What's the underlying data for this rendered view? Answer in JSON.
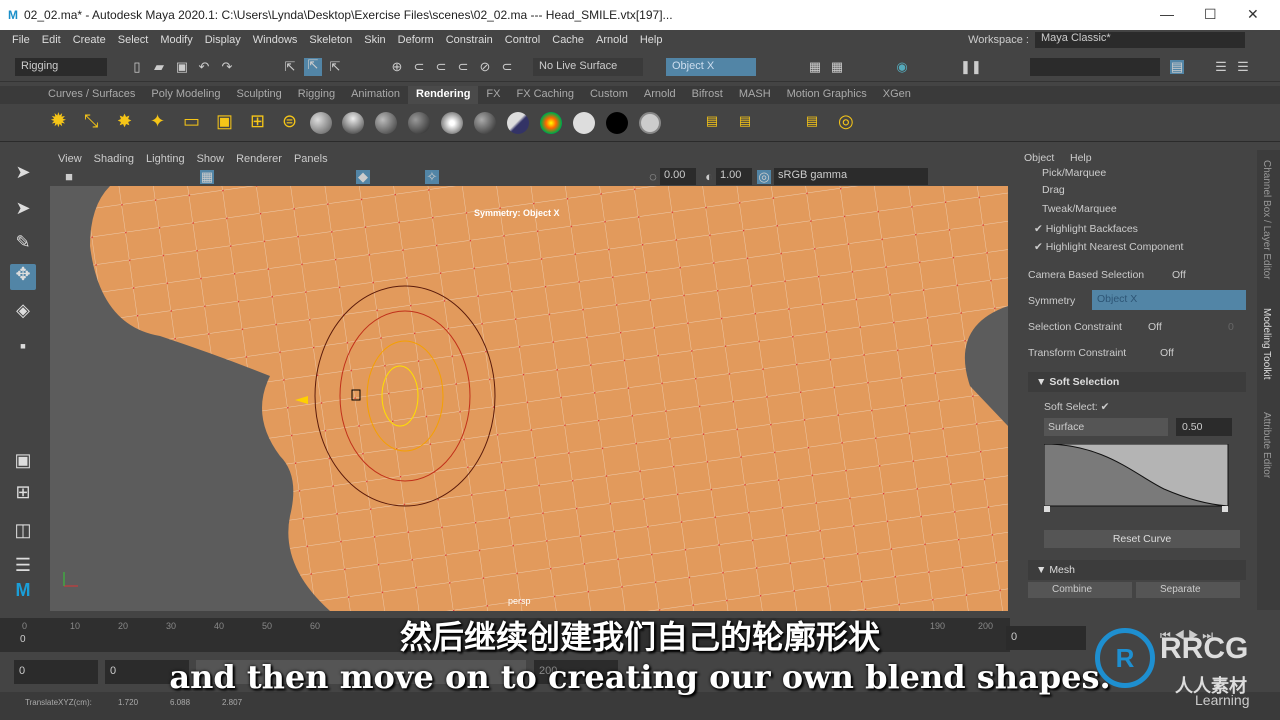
{
  "window": {
    "title": "02_02.ma* - Autodesk Maya 2020.1: C:\\Users\\Lynda\\Desktop\\Exercise Files\\scenes\\02_02.ma   ---   Head_SMILE.vtx[197]...",
    "logo": "M"
  },
  "menu": [
    "File",
    "Edit",
    "Create",
    "Select",
    "Modify",
    "Display",
    "Windows",
    "Skeleton",
    "Skin",
    "Deform",
    "Constrain",
    "Control",
    "Cache",
    "Arnold",
    "Help"
  ],
  "workspace": {
    "label": "Workspace :",
    "value": "Maya Classic*"
  },
  "status": {
    "menuset": "Rigging",
    "live_surface": "No Live Surface",
    "symmetry": "Object X"
  },
  "shelf_tabs": [
    "Curves / Surfaces",
    "Poly Modeling",
    "Sculpting",
    "Rigging",
    "Animation",
    "Rendering",
    "FX",
    "FX Caching",
    "Custom",
    "Arnold",
    "Bifrost",
    "MASH",
    "Motion Graphics",
    "XGen"
  ],
  "shelf_active": "Rendering",
  "viewport": {
    "menu": [
      "View",
      "Shading",
      "Lighting",
      "Show",
      "Renderer",
      "Panels"
    ],
    "exposure": "0.00",
    "gamma": "1.00",
    "colorspace": "sRGB gamma",
    "symmetry_hud": "Symmetry: Object X",
    "camera": "persp",
    "mesh_color": "#e29a5c"
  },
  "panel": {
    "menu": [
      "Object",
      "Help"
    ],
    "pick": "Pick/Marquee",
    "drag": "Drag",
    "tweak": "Tweak/Marquee",
    "highlight_backfaces": "Highlight Backfaces",
    "highlight_nearest": "Highlight Nearest Component",
    "camera_sel_label": "Camera Based Selection",
    "camera_sel_value": "Off",
    "symmetry_label": "Symmetry",
    "symmetry_value": "Object X",
    "sel_constraint_label": "Selection Constraint",
    "sel_constraint_value": "Off",
    "sel_constraint_num": "0",
    "xform_constraint_label": "Transform Constraint",
    "xform_constraint_value": "Off",
    "soft_section": "Soft Selection",
    "soft_select_label": "Soft Select:",
    "falloff_mode": "Surface",
    "falloff_radius": "0.50",
    "reset_curve": "Reset Curve",
    "mesh_section": "Mesh",
    "combine": "Combine",
    "separate": "Separate"
  },
  "side_tabs": [
    "Channel Box / Layer Editor",
    "Modeling Toolkit",
    "Attribute Editor"
  ],
  "timeline": {
    "ticks": [
      "0",
      "10",
      "20",
      "30",
      "40",
      "50",
      "60",
      "190",
      "200"
    ],
    "current": "0",
    "current_field": "0"
  },
  "range": {
    "start": "0",
    "start2": "0",
    "end": "200"
  },
  "translate": {
    "label": "TranslateXYZ(cm):",
    "x": "1.720",
    "y": "6.088",
    "z": "2.807"
  },
  "subtitles": {
    "zh": "然后继续创建我们自己的轮廓形状",
    "en": "and then move on to creating our own blend shapes."
  },
  "watermark": {
    "brand": "RRCG",
    "brand_zh": "人人素材",
    "linkedin": "Learning"
  }
}
